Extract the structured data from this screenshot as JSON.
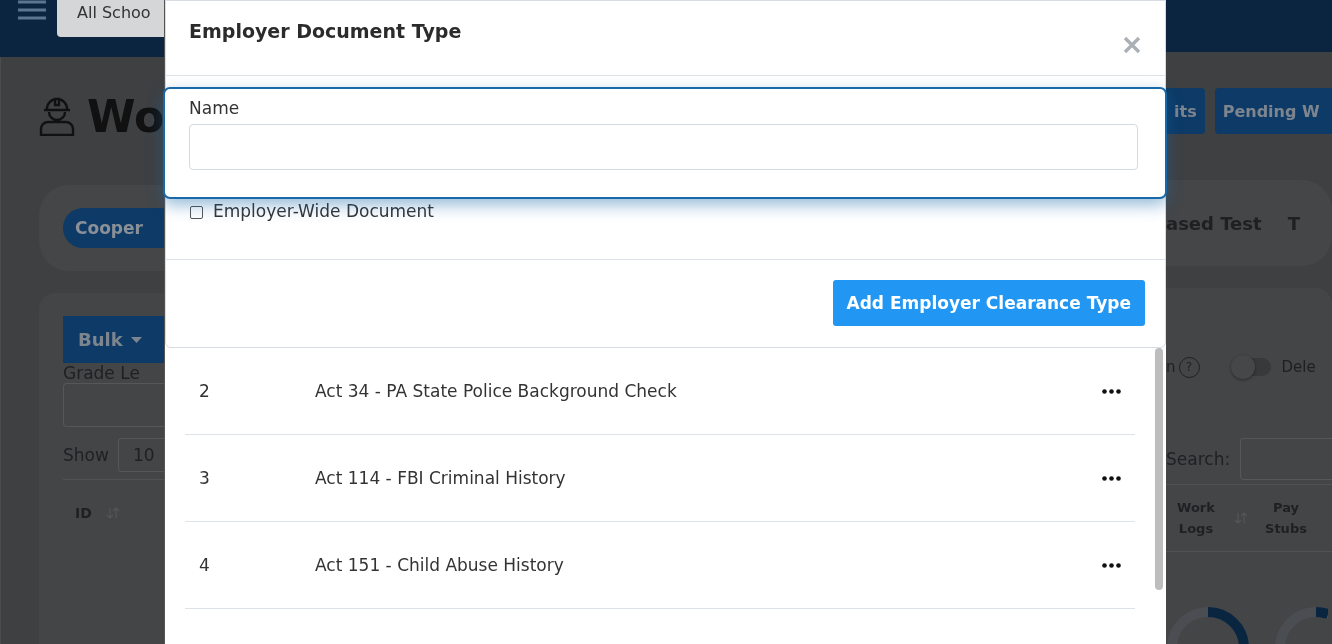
{
  "background": {
    "school_select": "All Schoo",
    "title": "Wo",
    "header_buttons": [
      "its",
      "Pending W"
    ],
    "filter_tabs": [
      {
        "label": "Cooper",
        "selected": true
      },
      {
        "label": "ased Test",
        "selected": false
      },
      {
        "label": "T",
        "selected": false
      }
    ],
    "bulk_button": "Bulk",
    "grade_label": "Grade Le",
    "show_label": "Show",
    "show_value": "10",
    "option_label": "n",
    "help": "?",
    "toggle": {
      "label": "Dele",
      "on": false
    },
    "search_label": "Search:",
    "columns": [
      {
        "label": "ID",
        "sortable": true
      },
      {
        "label": "Work Logs",
        "sortable": true
      },
      {
        "label": "Pay Stubs",
        "sortable": false
      }
    ]
  },
  "modal": {
    "title": "Employer Document Type",
    "name_label": "Name",
    "checkbox": {
      "label": "Employer-Wide Document",
      "checked": false
    },
    "submit": "Add Employer Clearance Type"
  },
  "document_types": [
    {
      "id": "2",
      "name": "Act 34 - PA State Police Background Check"
    },
    {
      "id": "3",
      "name": "Act 114 - FBI Criminal History"
    },
    {
      "id": "4",
      "name": "Act 151 - Child Abuse History"
    }
  ]
}
